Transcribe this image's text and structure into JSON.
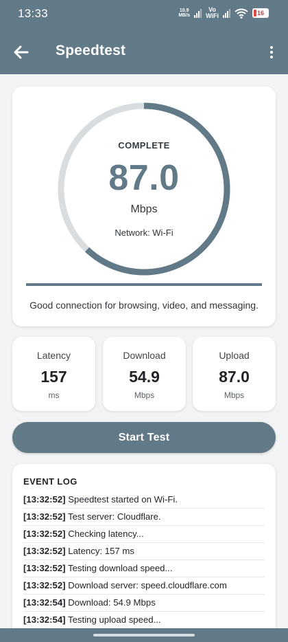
{
  "status_bar": {
    "time": "13:33",
    "net_speed_value": "10.9",
    "net_speed_unit": "MB/s",
    "network_top": "Vo",
    "network_bottom": "WiFi",
    "battery": "16",
    "icons": [
      "signal-icon",
      "wifi-icon",
      "battery-icon"
    ]
  },
  "app_bar": {
    "title": "Speedtest",
    "back_icon": "arrow-left-icon",
    "menu_icon": "more-vertical-icon"
  },
  "gauge": {
    "status": "COMPLETE",
    "value": "87.0",
    "unit": "Mbps",
    "network": "Network: Wi-Fi",
    "fill_fraction": 0.62,
    "progress_fraction": 1.0,
    "message": "Good connection for browsing, video, and messaging."
  },
  "stats": [
    {
      "label": "Latency",
      "value": "157",
      "unit": "ms"
    },
    {
      "label": "Download",
      "value": "54.9",
      "unit": "Mbps"
    },
    {
      "label": "Upload",
      "value": "87.0",
      "unit": "Mbps"
    }
  ],
  "start_button": {
    "label": "Start Test"
  },
  "event_log": {
    "title": "EVENT LOG",
    "entries": [
      {
        "time": "[13:32:52]",
        "text": " Speedtest started on Wi-Fi."
      },
      {
        "time": "[13:32:52]",
        "text": " Test server: Cloudflare."
      },
      {
        "time": "[13:32:52]",
        "text": " Checking latency..."
      },
      {
        "time": "[13:32:52]",
        "text": " Latency: 157 ms"
      },
      {
        "time": "[13:32:52]",
        "text": " Testing download speed..."
      },
      {
        "time": "[13:32:52]",
        "text": " Download server: speed.cloudflare.com"
      },
      {
        "time": "[13:32:54]",
        "text": " Download: 54.9 Mbps"
      },
      {
        "time": "[13:32:54]",
        "text": " Testing upload speed..."
      }
    ]
  },
  "colors": {
    "primary": "#627987",
    "track": "#d9dddf",
    "background": "#f1f3f4"
  }
}
